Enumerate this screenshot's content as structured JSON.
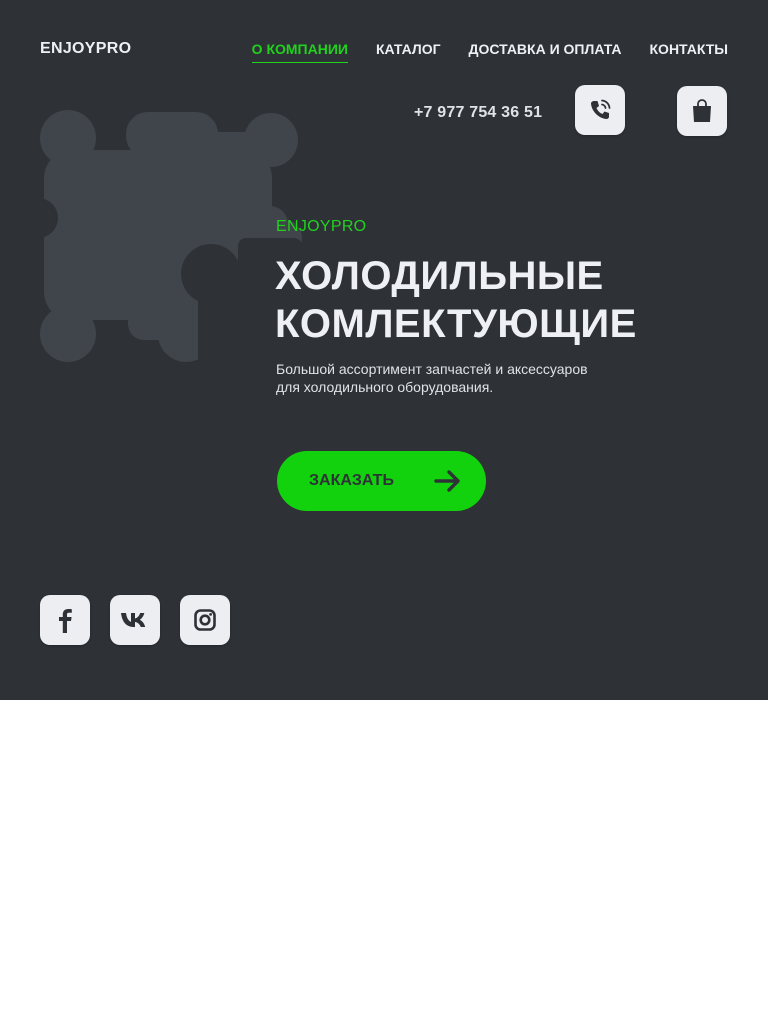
{
  "header": {
    "logo": "ENJOYPRO",
    "nav": [
      {
        "label": "О КОМПАНИИ",
        "active": true
      },
      {
        "label": "КАТАЛОГ",
        "active": false
      },
      {
        "label": "ДОСТАВКА И ОПЛАТА",
        "active": false
      },
      {
        "label": "КОНТАКТЫ",
        "active": false
      }
    ],
    "phone": "+7 977 754 36 51"
  },
  "hero": {
    "tag": "ENJOYPRO",
    "title_line1": "ХОЛОДИЛЬНЫЕ",
    "title_line2": "КОМЛЕКТУЮЩИЕ",
    "subtitle_line1": "Большой ассортимент запчастей и аксессуаров",
    "subtitle_line2": "для холодильного оборудования.",
    "cta_label": "ЗАКАЗАТЬ"
  },
  "icons": {
    "call": "phone-call-icon",
    "cart": "shopping-bag-icon",
    "arrow": "arrow-right-icon",
    "social": [
      "facebook-icon",
      "vk-icon",
      "instagram-icon"
    ],
    "decoration": "puzzle-piece-icon"
  },
  "colors": {
    "background": "#2e3237",
    "accent": "#12d10d",
    "text": "#eef0f3",
    "puzzle": "#40454b",
    "button_light": "#eceef1"
  }
}
